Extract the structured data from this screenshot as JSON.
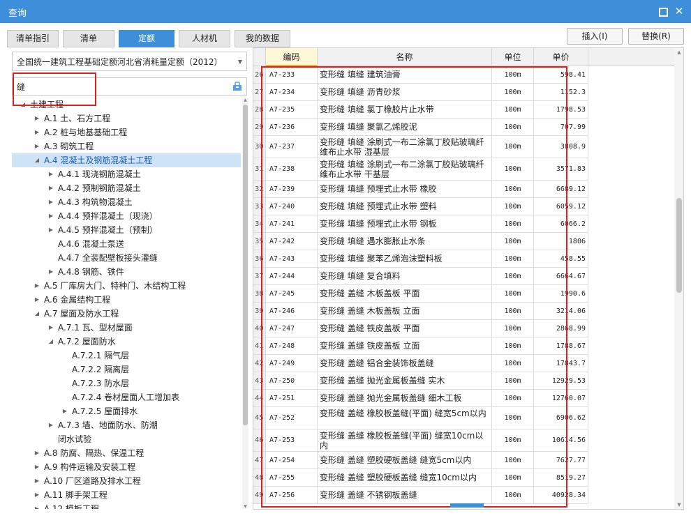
{
  "window": {
    "title": "查询",
    "maximize_icon": "maximize-icon",
    "close_icon": "close-icon",
    "close_glyph": "✕"
  },
  "tabs": [
    {
      "label": "清单指引",
      "active": false
    },
    {
      "label": "清单",
      "active": false
    },
    {
      "label": "定额",
      "active": true
    },
    {
      "label": "人材机",
      "active": false
    },
    {
      "label": "我的数据",
      "active": false
    }
  ],
  "actions": {
    "insert_label": "插入(I)",
    "replace_label": "替换(R)"
  },
  "left": {
    "library": "全国统一建筑工程基础定额河北省消耗量定额（2012）",
    "search_value": "缝",
    "tree": [
      {
        "label": "土建工程",
        "level": 0,
        "expanded": true,
        "has_children": true
      },
      {
        "label": "A.1 土、石方工程",
        "level": 1,
        "expanded": false,
        "has_children": true
      },
      {
        "label": "A.2 桩与地基基础工程",
        "level": 1,
        "expanded": false,
        "has_children": true
      },
      {
        "label": "A.3 砌筑工程",
        "level": 1,
        "expanded": false,
        "has_children": true
      },
      {
        "label": "A.4 混凝土及钢筋混凝土工程",
        "level": 1,
        "expanded": true,
        "has_children": true,
        "selected": true
      },
      {
        "label": "A.4.1 现浇钢筋混凝土",
        "level": 2,
        "expanded": false,
        "has_children": true
      },
      {
        "label": "A.4.2 预制钢筋混凝土",
        "level": 2,
        "expanded": false,
        "has_children": true
      },
      {
        "label": "A.4.3 构筑物混凝土",
        "level": 2,
        "expanded": false,
        "has_children": true
      },
      {
        "label": "A.4.4 预拌混凝土（现浇）",
        "level": 2,
        "expanded": false,
        "has_children": true
      },
      {
        "label": "A.4.5 预拌混凝土（预制）",
        "level": 2,
        "expanded": false,
        "has_children": true
      },
      {
        "label": "A.4.6 混凝土泵送",
        "level": 2,
        "expanded": false,
        "has_children": false
      },
      {
        "label": "A.4.7 全装配壁板接头灌缝",
        "level": 2,
        "expanded": false,
        "has_children": false
      },
      {
        "label": "A.4.8 钢筋、铁件",
        "level": 2,
        "expanded": false,
        "has_children": true
      },
      {
        "label": "A.5 厂库房大门、特种门、木结构工程",
        "level": 1,
        "expanded": false,
        "has_children": true
      },
      {
        "label": "A.6 金属结构工程",
        "level": 1,
        "expanded": false,
        "has_children": true
      },
      {
        "label": "A.7 屋面及防水工程",
        "level": 1,
        "expanded": true,
        "has_children": true
      },
      {
        "label": "A.7.1 瓦、型材屋面",
        "level": 2,
        "expanded": false,
        "has_children": true
      },
      {
        "label": "A.7.2 屋面防水",
        "level": 2,
        "expanded": true,
        "has_children": true
      },
      {
        "label": "A.7.2.1 隔气层",
        "level": 3,
        "expanded": false,
        "has_children": false
      },
      {
        "label": "A.7.2.2 隔离层",
        "level": 3,
        "expanded": false,
        "has_children": false
      },
      {
        "label": "A.7.2.3 防水层",
        "level": 3,
        "expanded": false,
        "has_children": false
      },
      {
        "label": "A.7.2.4 卷材屋面人工增加表",
        "level": 3,
        "expanded": false,
        "has_children": false
      },
      {
        "label": "A.7.2.5 屋面排水",
        "level": 3,
        "expanded": false,
        "has_children": true
      },
      {
        "label": "A.7.3 墙、地面防水、防潮",
        "level": 2,
        "expanded": false,
        "has_children": true
      },
      {
        "label": "闭水试验",
        "level": 2,
        "expanded": false,
        "has_children": false
      },
      {
        "label": "A.8 防腐、隔热、保温工程",
        "level": 1,
        "expanded": false,
        "has_children": true
      },
      {
        "label": "A.9 构件运输及安装工程",
        "level": 1,
        "expanded": false,
        "has_children": true
      },
      {
        "label": "A.10 厂区道路及排水工程",
        "level": 1,
        "expanded": false,
        "has_children": true
      },
      {
        "label": "A.11 脚手架工程",
        "level": 1,
        "expanded": false,
        "has_children": true
      },
      {
        "label": "A.12 模板工程",
        "level": 1,
        "expanded": false,
        "has_children": true
      }
    ]
  },
  "grid": {
    "headers": {
      "code": "编码",
      "name": "名称",
      "unit": "单位",
      "price": "单价"
    },
    "rows": [
      {
        "idx": "26",
        "code": "A7-233",
        "name": "变形缝 填缝 建筑油膏",
        "unit": "100m",
        "price": "598.41",
        "tall": false
      },
      {
        "idx": "27",
        "code": "A7-234",
        "name": "变形缝 填缝 沥青砂浆",
        "unit": "100m",
        "price": "1152.3",
        "tall": false
      },
      {
        "idx": "28",
        "code": "A7-235",
        "name": "变形缝 填缝 氯丁橡胶片止水带",
        "unit": "100m",
        "price": "1798.53",
        "tall": false
      },
      {
        "idx": "29",
        "code": "A7-236",
        "name": "变形缝 填缝 聚氯乙烯胶泥",
        "unit": "100m",
        "price": "707.99",
        "tall": false
      },
      {
        "idx": "30",
        "code": "A7-237",
        "name": "变形缝 填缝 涂刷式一布二涂氯丁胶贴玻璃纤维布止水带 湿基层",
        "unit": "100m",
        "price": "3808.9",
        "tall": true
      },
      {
        "idx": "31",
        "code": "A7-238",
        "name": "变形缝 填缝 涂刷式一布二涂氯丁胶贴玻璃纤维布止水带 干基层",
        "unit": "100m",
        "price": "3571.83",
        "tall": true
      },
      {
        "idx": "32",
        "code": "A7-239",
        "name": "变形缝 填缝 预埋式止水带 橡胶",
        "unit": "100m",
        "price": "6689.12",
        "tall": false
      },
      {
        "idx": "33",
        "code": "A7-240",
        "name": "变形缝 填缝 预埋式止水带 塑料",
        "unit": "100m",
        "price": "6059.12",
        "tall": false
      },
      {
        "idx": "34",
        "code": "A7-241",
        "name": "变形缝 填缝 预埋式止水带 钢板",
        "unit": "100m",
        "price": "6066.2",
        "tall": false
      },
      {
        "idx": "35",
        "code": "A7-242",
        "name": "变形缝 填缝 遇水膨胀止水条",
        "unit": "100m",
        "price": "1806",
        "tall": false
      },
      {
        "idx": "36",
        "code": "A7-243",
        "name": "变形缝 填缝 聚苯乙烯泡沫塑料板",
        "unit": "100m",
        "price": "458.55",
        "tall": false
      },
      {
        "idx": "37",
        "code": "A7-244",
        "name": "变形缝 填缝 复合填料",
        "unit": "100m",
        "price": "6664.67",
        "tall": false
      },
      {
        "idx": "38",
        "code": "A7-245",
        "name": "变形缝 盖缝 木板盖板 平面",
        "unit": "100m",
        "price": "1990.6",
        "tall": false
      },
      {
        "idx": "39",
        "code": "A7-246",
        "name": "变形缝 盖缝 木板盖板 立面",
        "unit": "100m",
        "price": "3214.06",
        "tall": false
      },
      {
        "idx": "40",
        "code": "A7-247",
        "name": "变形缝 盖缝 铁皮盖板 平面",
        "unit": "100m",
        "price": "2868.99",
        "tall": false
      },
      {
        "idx": "41",
        "code": "A7-248",
        "name": "变形缝 盖缝 铁皮盖板 立面",
        "unit": "100m",
        "price": "1788.67",
        "tall": false
      },
      {
        "idx": "42",
        "code": "A7-249",
        "name": "变形缝 盖缝 铝合金装饰板盖缝",
        "unit": "100m",
        "price": "17843.7",
        "tall": false
      },
      {
        "idx": "43",
        "code": "A7-250",
        "name": "变形缝 盖缝 抛光金属板盖缝 实木",
        "unit": "100m",
        "price": "12929.53",
        "tall": false
      },
      {
        "idx": "44",
        "code": "A7-251",
        "name": "变形缝 盖缝 抛光金属板盖缝 细木工板",
        "unit": "100m",
        "price": "12760.07",
        "tall": false
      },
      {
        "idx": "45",
        "code": "A7-252",
        "name": "变形缝 盖缝 橡胶板盖缝(平面) 缝宽5cm以内",
        "unit": "100m",
        "price": "6906.62",
        "tall": true
      },
      {
        "idx": "46",
        "code": "A7-253",
        "name": "变形缝 盖缝 橡胶板盖缝(平面) 缝宽10cm以内",
        "unit": "100m",
        "price": "10614.56",
        "tall": true
      },
      {
        "idx": "47",
        "code": "A7-254",
        "name": "变形缝 盖缝 塑胶硬板盖缝 缝宽5cm以内",
        "unit": "100m",
        "price": "7627.77",
        "tall": false
      },
      {
        "idx": "48",
        "code": "A7-255",
        "name": "变形缝 盖缝 塑胶硬板盖缝 缝宽10cm以内",
        "unit": "100m",
        "price": "8519.27",
        "tall": false
      },
      {
        "idx": "49",
        "code": "A7-256",
        "name": "变形缝 盖缝 不锈钢板盖缝",
        "unit": "100m",
        "price": "40928.34",
        "tall": false
      }
    ]
  },
  "colors": {
    "accent": "#3c8fd8",
    "highlight": "#e11d1d",
    "selected_row": "#cfe3f7"
  }
}
